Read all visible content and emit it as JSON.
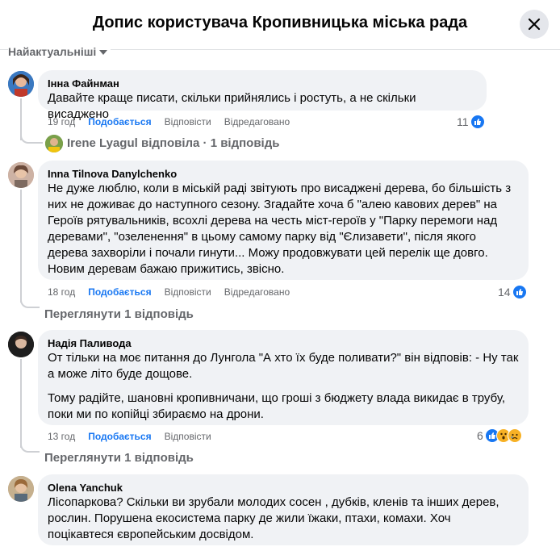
{
  "header": {
    "title": "Допис користувача Кропивницька міська рада"
  },
  "sort": {
    "label": "Найактуальніші"
  },
  "comments": [
    {
      "author": "Інна Файнман",
      "text": [
        "Давайте краще писати, скільки прийнялись і ростуть, а не скільки висаджено"
      ],
      "time": "19 год",
      "like_label": "Подобається",
      "reply_label": "Відповісти",
      "edited_label": "Відредаговано",
      "reactions": "11",
      "reply_summary": "Irene Lyagul відповіла · 1 відповідь"
    },
    {
      "author": "Inna Tilnova Danylchenko",
      "text": [
        "Не дуже люблю, коли в міській раді звітують про висаджені дерева, бо більшість з них не доживає до наступного сезону. Згадайте хоча б \"алею кавових дерев\" на Героїв рятувальників, всохлі дерева на честь міст-героїв у \"Парку перемоги над деревами\", \"озеленення\" в цьому самому парку від \"Єлизавети\", після якого дерева захворіли і почали гинути... Можу продовжувати цей перелік ще довго.",
        "Новим деревам бажаю прижитись, звісно."
      ],
      "time": "18 год",
      "like_label": "Подобається",
      "reply_label": "Відповісти",
      "edited_label": "Відредаговано",
      "reactions": "14",
      "view_replies": "Переглянути 1 відповідь"
    },
    {
      "author": "Надія Паливода",
      "text": [
        "От тільки на моє питання до Лунгола \"А хто їх буде поливати?\" він відповів: - Ну так а може літо буде дощове.",
        "Тому радійте, шановні кропивничани, що гроші з бюджету влада викидає в трубу, поки ми по копійці збираємо на дрони."
      ],
      "time": "13 год",
      "like_label": "Подобається",
      "reply_label": "Відповісти",
      "reactions": "6",
      "view_replies": "Переглянути 1 відповідь"
    },
    {
      "author": "Olena Yanchuk",
      "text": [
        "Лісопаркова? Скільки ви зрубали молодих сосен , дубків, кленів та інших дерев, рослин. Порушена екосистема парку де жили їжаки, птахи, комахи. Хоч поцікавтеся європейським досвідом."
      ]
    }
  ],
  "colors": {
    "link_blue": "#1877f2",
    "bubble_bg": "#f0f2f5",
    "muted": "#65676b"
  },
  "icons": [
    "close-icon",
    "caret-down-icon",
    "like-icon",
    "wow-icon",
    "sad-icon"
  ]
}
